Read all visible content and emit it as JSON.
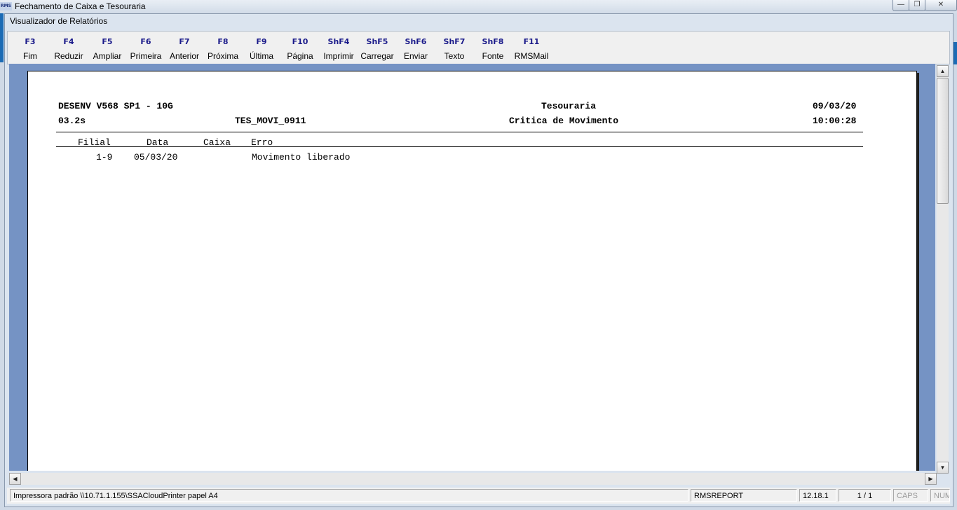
{
  "window": {
    "logo_text": "RMS",
    "title": "Fechamento de Caixa e Tesouraria",
    "min_glyph": "—",
    "restore_glyph": "❐",
    "close_glyph": "✕"
  },
  "dialog": {
    "title": "Visualizador de Relatórios"
  },
  "toolbar": [
    {
      "key": "F3",
      "label": "Fim"
    },
    {
      "key": "F4",
      "label": "Reduzir"
    },
    {
      "key": "F5",
      "label": "Ampliar"
    },
    {
      "key": "F6",
      "label": "Primeira"
    },
    {
      "key": "F7",
      "label": "Anterior"
    },
    {
      "key": "F8",
      "label": "Próxima"
    },
    {
      "key": "F9",
      "label": "Última"
    },
    {
      "key": "F10",
      "label": "Página"
    },
    {
      "key": "ShF4",
      "label": "Imprimir"
    },
    {
      "key": "ShF5",
      "label": "Carregar"
    },
    {
      "key": "ShF6",
      "label": "Enviar"
    },
    {
      "key": "ShF7",
      "label": "Texto"
    },
    {
      "key": "ShF8",
      "label": "Fonte"
    },
    {
      "key": "F11",
      "label": "RMSMail"
    }
  ],
  "report": {
    "system": "DESENV V568 SP1 - 10G",
    "section": "Tesouraria",
    "date": "09/03/20",
    "version": "03.2s",
    "program": "TES_MOVI_0911",
    "report_title": "Critica de Movimento",
    "time": "10:00:28",
    "columns": {
      "filial": "Filial",
      "data": "Data",
      "caixa": "Caixa",
      "erro": "Erro"
    },
    "rows": [
      {
        "filial": "1-9",
        "data": "05/03/20",
        "caixa": "",
        "erro": "Movimento liberado"
      }
    ]
  },
  "scroll": {
    "up": "▲",
    "down": "▼",
    "left": "◀",
    "right": "▶"
  },
  "status": {
    "printer": "Impressora padrão \\\\10.71.1.155\\SSACloudPrinter papel A4",
    "module": "RMSREPORT",
    "version": "12.18.1",
    "page": "1 / 1",
    "caps": "CAPS",
    "num": "NUM"
  }
}
